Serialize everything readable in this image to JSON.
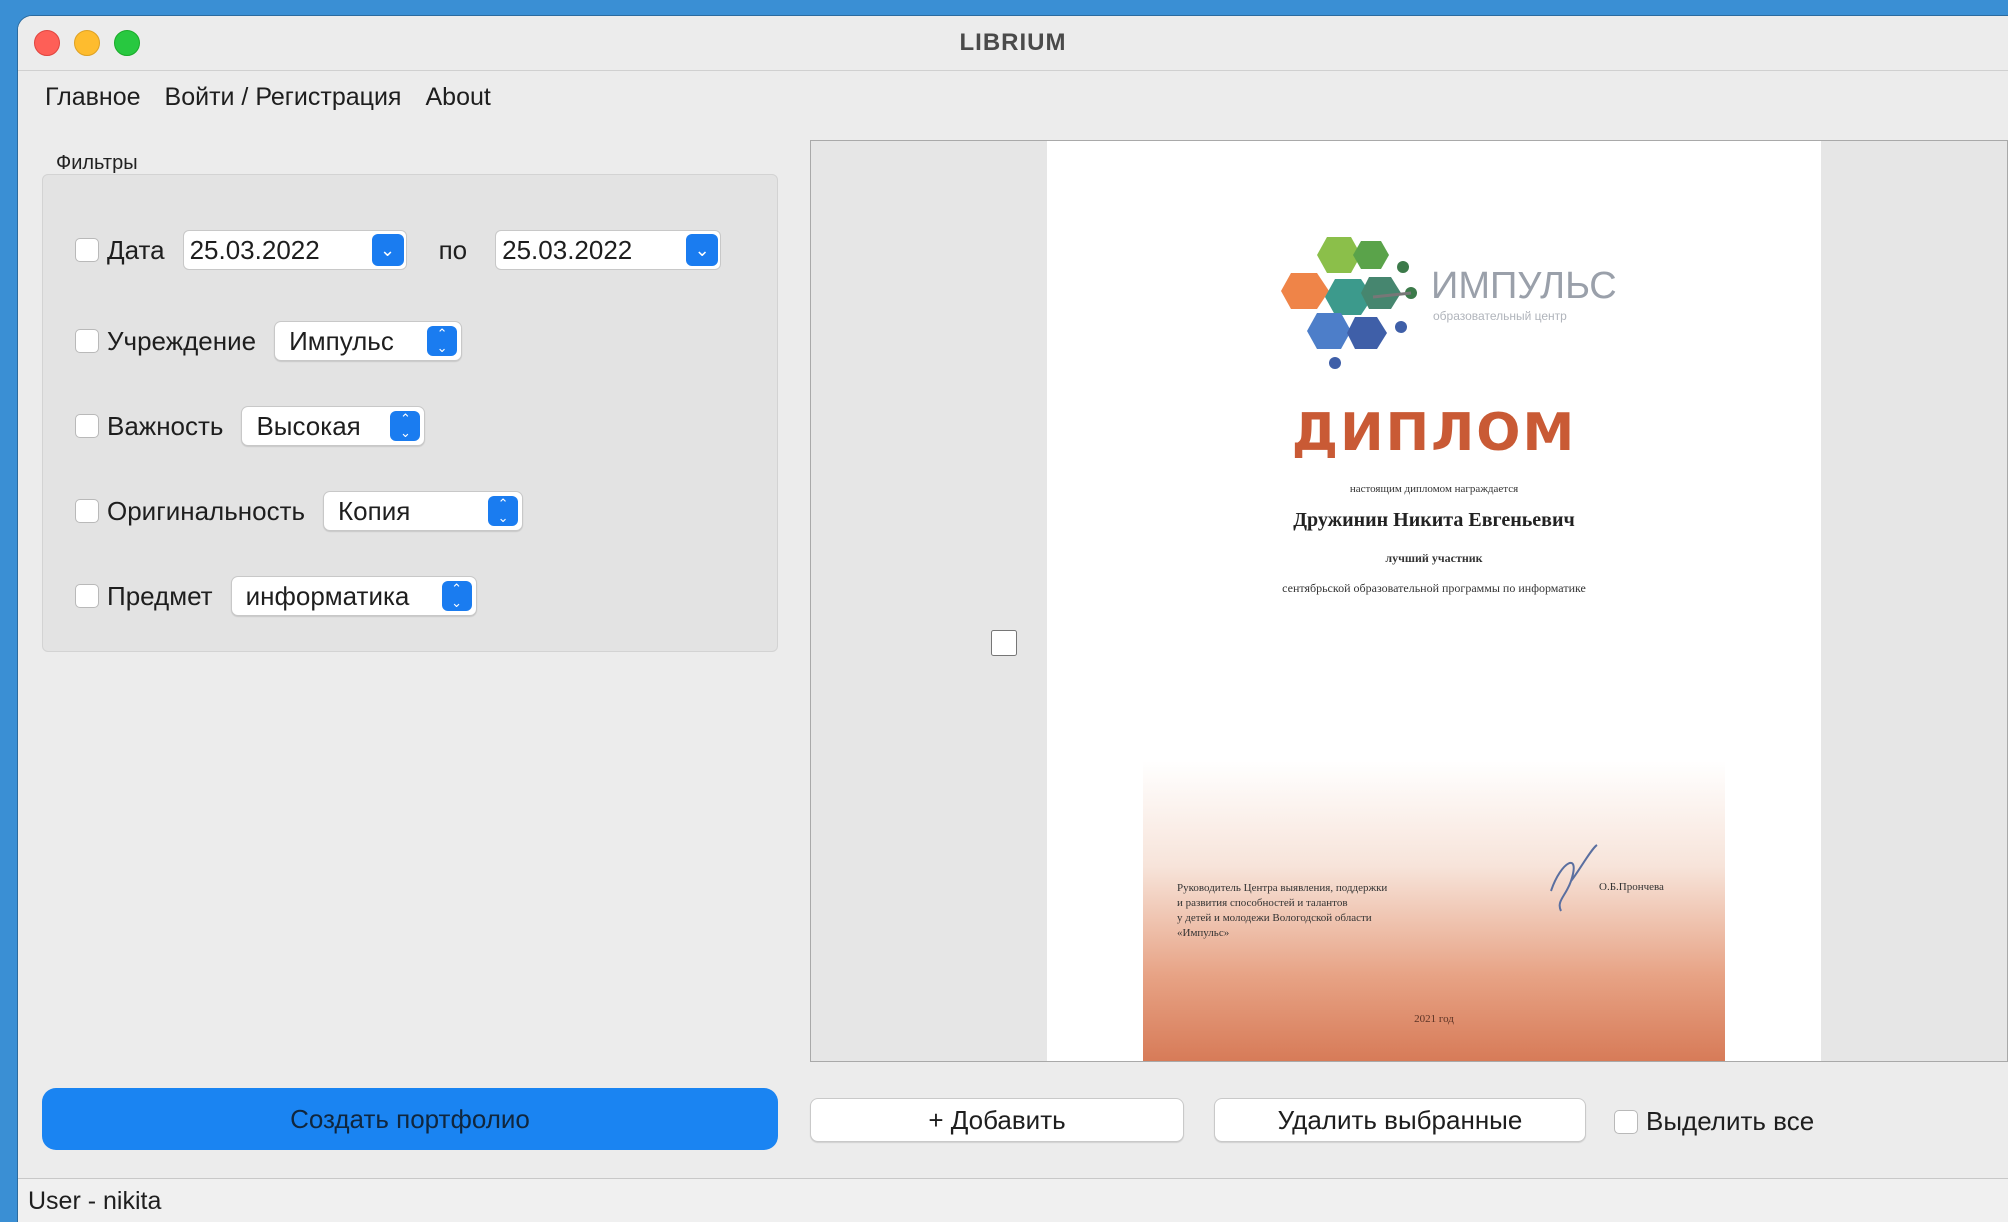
{
  "window": {
    "title": "LIBRIUM"
  },
  "menu": {
    "items": [
      "Главное",
      "Войти / Регистрация",
      "About"
    ]
  },
  "filters": {
    "title": "Фильтры",
    "date": {
      "label": "Дата",
      "from": "25.03.2022",
      "separator": "по",
      "to": "25.03.2022",
      "checked": false
    },
    "institution": {
      "label": "Учреждение",
      "value": "Импульс",
      "checked": false
    },
    "importance": {
      "label": "Важность",
      "value": "Высокая",
      "checked": false
    },
    "originality": {
      "label": "Оригинальность",
      "value": "Копия",
      "checked": false
    },
    "subject": {
      "label": "Предмет",
      "value": "информатика",
      "checked": false
    }
  },
  "preview": {
    "item_checked": false,
    "document": {
      "logo_text": "ИМПУЛЬС",
      "logo_sub": "образовательный центр",
      "title": "ДИПЛОМ",
      "line1": "настоящим дипломом награждается",
      "name": "Дружинин Никита Евгеньевич",
      "line2": "лучший участник",
      "line3": "сентябрьской образовательной программы по информатике",
      "signature_block": [
        "Руководитель Центра выявления, поддержки",
        "и развития способностей и талантов",
        "у детей и молодежи Вологодской области",
        "«Импульс»"
      ],
      "signature_name": "О.Б.Прончева",
      "year": "2021 год"
    }
  },
  "actions": {
    "create_portfolio": "Создать портфолио",
    "add": "+ Добавить",
    "delete_selected": "Удалить выбранные",
    "select_all": "Выделить все"
  },
  "status": {
    "text": "User - nikita"
  },
  "colors": {
    "accent": "#1a84f2",
    "diploma_title": "#c95a35"
  }
}
